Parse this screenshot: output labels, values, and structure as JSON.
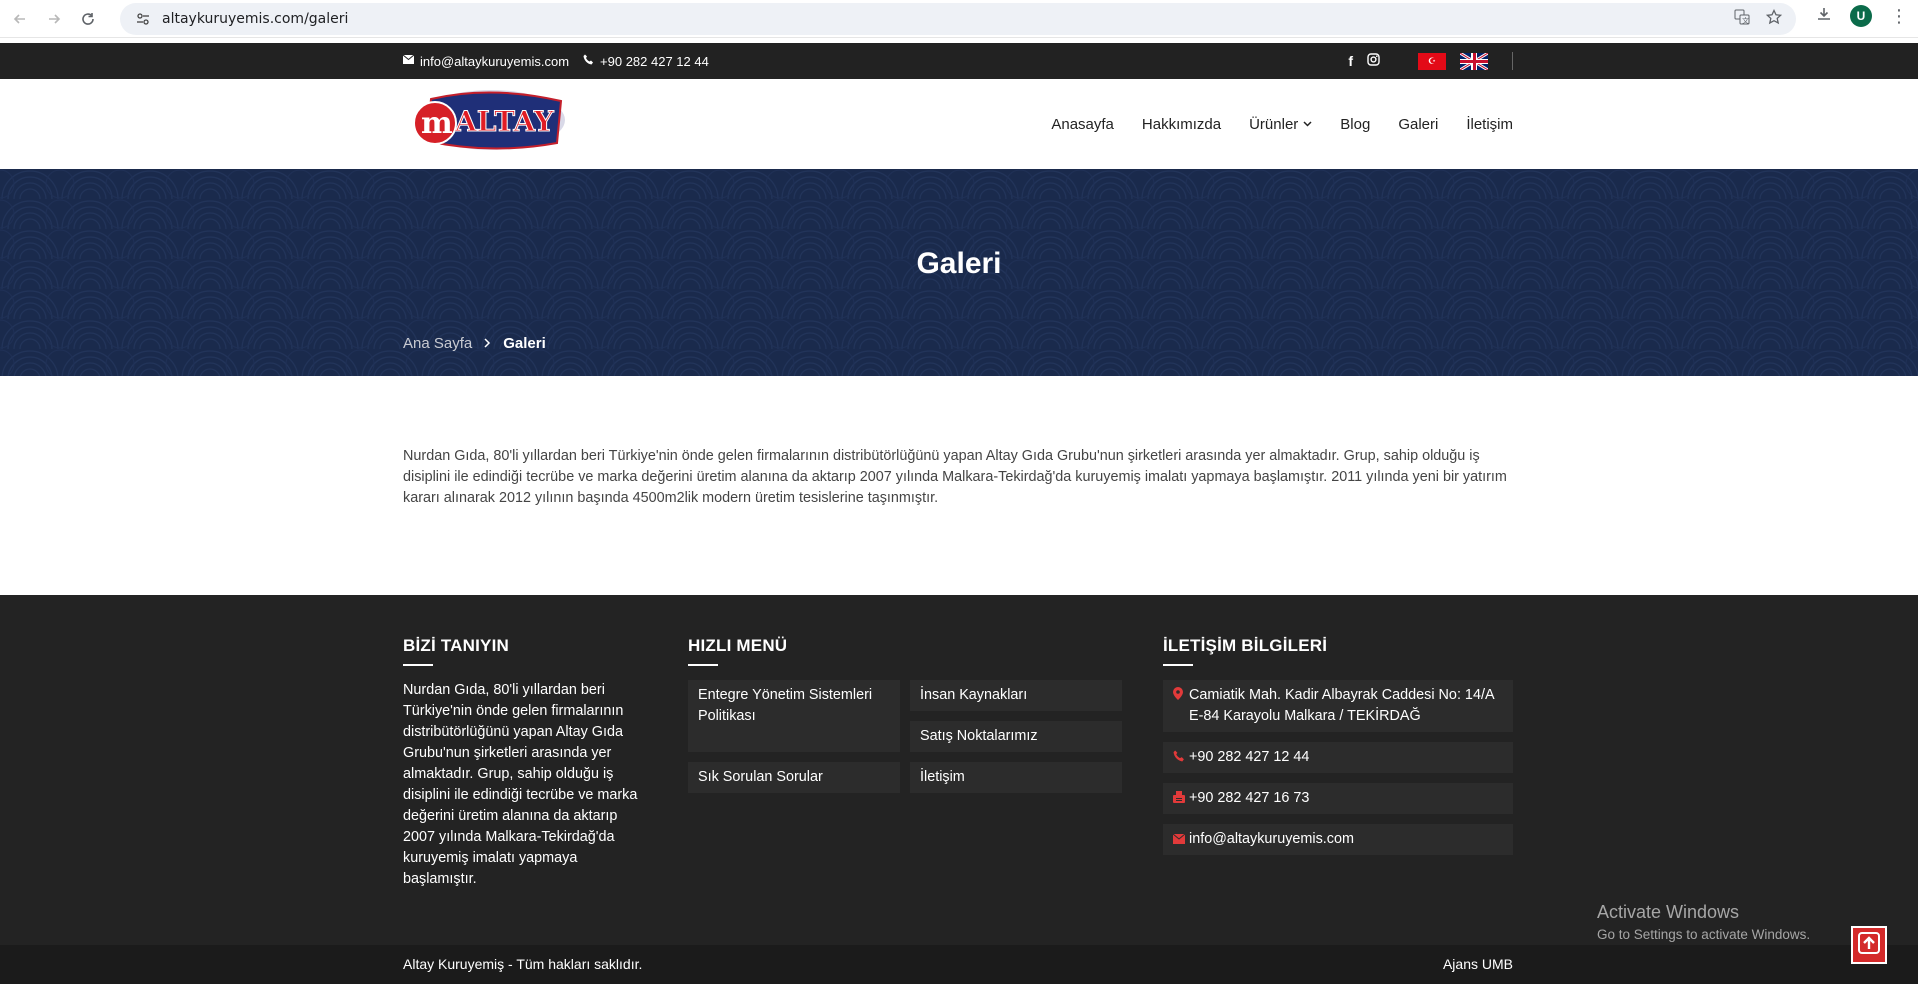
{
  "browser": {
    "url": "altaykuruyemis.com/galeri",
    "profile_initial": "U"
  },
  "topbar": {
    "email": "info@altaykuruyemis.com",
    "phone": "+90 282 427 12 44",
    "social": {
      "facebook": "f",
      "instagram": "◎"
    },
    "lang_tr_symbol": "☪"
  },
  "header": {
    "logo": {
      "m": "m",
      "text": "ALTAY"
    },
    "nav": [
      {
        "label": "Anasayfa"
      },
      {
        "label": "Hakkımızda"
      },
      {
        "label": "Ürünler"
      },
      {
        "label": "Blog"
      },
      {
        "label": "Galeri"
      },
      {
        "label": "İletişim"
      }
    ]
  },
  "banner": {
    "title": "Galeri",
    "breadcrumb_home": "Ana Sayfa",
    "breadcrumb_current": "Galeri"
  },
  "intro": {
    "text": "Nurdan Gıda, 80'li yıllardan beri Türkiye'nin önde gelen firmalarının distribütörlüğünü yapan Altay Gıda Grubu'nun şirketleri arasında yer almaktadır. Grup, sahip olduğu iş disiplini ile edindiği tecrübe ve marka değerini üretim alanına da aktarıp 2007 yılında Malkara-Tekirdağ'da kuruyemiş imalatı yapmaya başlamıştır. 2011 yılında yeni bir yatırım kararı alınarak 2012 yılının başında 4500m2lik modern üretim tesislerine taşınmıştır."
  },
  "footer": {
    "about": {
      "title": "BİZİ TANIYIN",
      "text": "Nurdan Gıda, 80'li yıllardan beri Türkiye'nin önde gelen firmalarının distribütörlüğünü yapan Altay Gıda Grubu'nun şirketleri arasında yer almaktadır. Grup, sahip olduğu iş disiplini ile edindiği tecrübe ve marka değerini üretim alanına da aktarıp 2007 yılında Malkara-Tekirdağ'da kuruyemiş imalatı yapmaya başlamıştır."
    },
    "menu": {
      "title": "HIZLI MENÜ",
      "items": [
        {
          "label": "Entegre Yönetim Sistemleri Politikası"
        },
        {
          "label": "İnsan Kaynakları"
        },
        {
          "label": "Satış Noktalarımız"
        },
        {
          "label": "Sık Sorulan Sorular"
        },
        {
          "label": "İletişim"
        }
      ]
    },
    "contact": {
      "title": "İLETİŞİM BİLGİLERİ",
      "address": "Camiatik Mah. Kadir Albayrak Caddesi No: 14/A E-84 Karayolu Malkara / TEKİRDAĞ",
      "phone": "+90 282 427 12 44",
      "fax": "+90 282 427 16 73",
      "email": "info@altaykuruyemis.com"
    },
    "copyright": "Altay Kuruyemiş - Tüm hakları saklıdır.",
    "agency": "Ajans UMB"
  },
  "os_overlay": {
    "title": "Activate Windows",
    "subtitle": "Go to Settings to activate Windows."
  },
  "colors": {
    "banner_bg": "#1a2a4c",
    "footer_bg": "#232323",
    "accent_red": "#d42a2a"
  }
}
